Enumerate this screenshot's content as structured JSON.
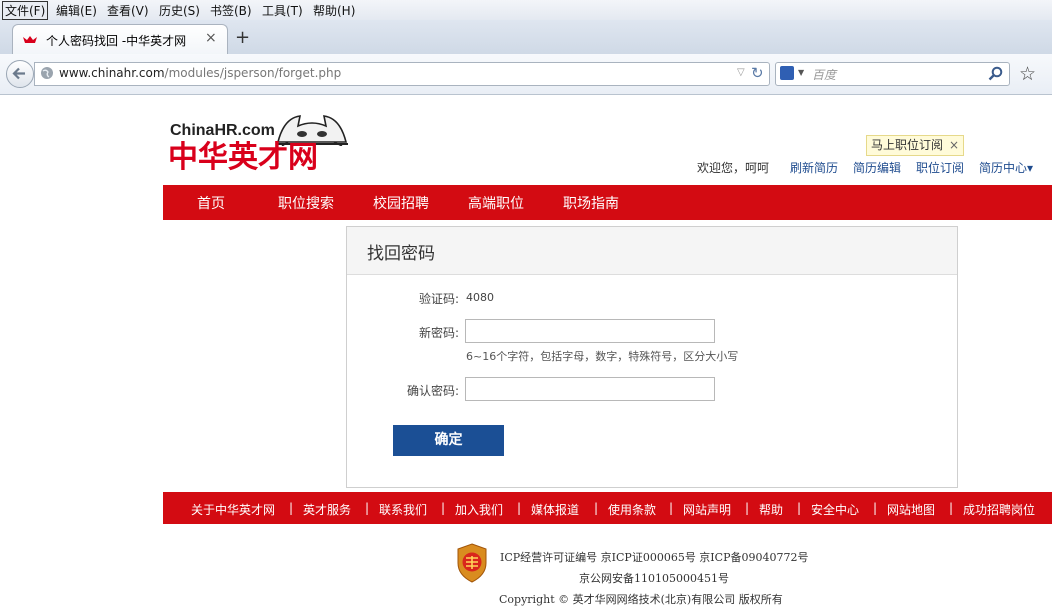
{
  "browser": {
    "menu": [
      "文件(F)",
      "编辑(E)",
      "查看(V)",
      "历史(S)",
      "书签(B)",
      "工具(T)",
      "帮助(H)"
    ],
    "tab_title": "个人密码找回 -中华英才网",
    "tab_close": "×",
    "new_tab": "+",
    "url_domain": "www.chinahr.com",
    "url_path": "/modules/jsperson/forget.php",
    "search_placeholder": "百度"
  },
  "header": {
    "logo_en": "ChinaHR.com",
    "logo_cn": "中华英才网",
    "subscribe_popup": "马上职位订阅",
    "popup_close": "×",
    "welcome": "欢迎您，呵呵",
    "links": [
      "刷新简历",
      "简历编辑",
      "职位订阅",
      "简历中心▾"
    ]
  },
  "nav": [
    "首页",
    "职位搜索",
    "校园招聘",
    "高端职位",
    "职场指南"
  ],
  "form": {
    "title": "找回密码",
    "captcha_label": "验证码:",
    "captcha_value": "4080",
    "new_password_label": "新密码:",
    "password_hint": "6~16个字符，包括字母，数字，特殊符号，区分大小写",
    "confirm_label": "确认密码:",
    "submit": "确定"
  },
  "footer_nav": [
    "关于中华英才网",
    "|",
    "英才服务",
    "|",
    "联系我们",
    "|",
    "加入我们",
    "|",
    "媒体报道",
    "|",
    "使用条款",
    "|",
    "网站声明",
    "|",
    "帮助",
    "|",
    "安全中心",
    "|",
    "网站地图",
    "|",
    "成功招聘岗位"
  ],
  "footer": {
    "icp": "ICP经营许可证编号 京ICP证000065号 京ICP备09040772号",
    "police": "京公网安备110105000451号",
    "copyright": "Copyright © 英才华网网络技术(北京)有限公司 版权所有"
  },
  "colors": {
    "brand_red": "#d30b12",
    "button_blue": "#1b4f95"
  }
}
